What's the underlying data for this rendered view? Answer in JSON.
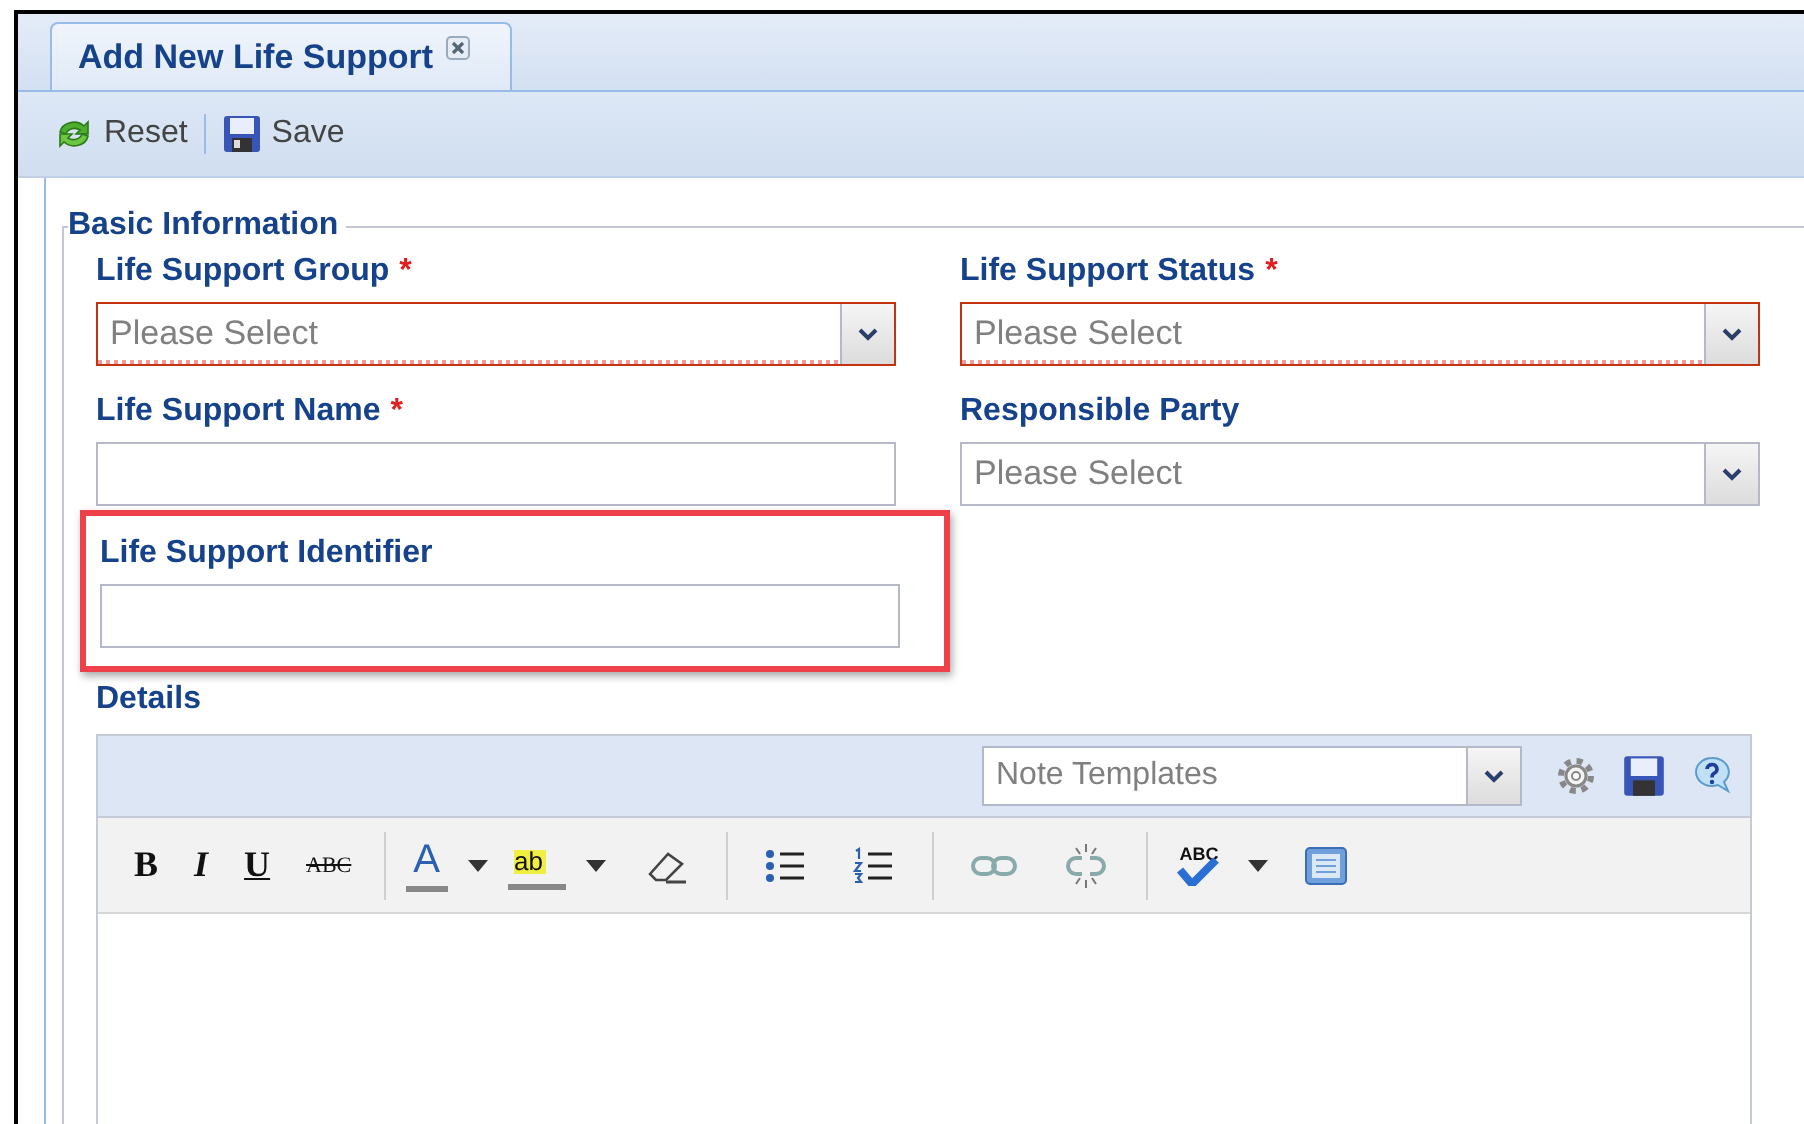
{
  "tab": {
    "label": "Add New Life Support",
    "selected": true
  },
  "toolbar": [
    {
      "kind": "reset",
      "label": "Reset"
    },
    {
      "kind": "save",
      "label": "Save"
    }
  ],
  "fieldset": {
    "legend": "Basic Information"
  },
  "fields": [
    {
      "kind": "select",
      "label": "Life Support Group",
      "required_mark": "*",
      "placeholder": "Please Select",
      "invalid": true,
      "highlighted": false
    },
    {
      "kind": "select",
      "label": "Life Support Status",
      "required_mark": "*",
      "placeholder": "Please Select",
      "invalid": true,
      "highlighted": false
    },
    {
      "kind": "text",
      "label": "Life Support Name",
      "required_mark": "*",
      "invalid": false,
      "highlighted": false
    },
    {
      "kind": "select",
      "label": "Responsible Party",
      "placeholder": "Please Select",
      "invalid": false,
      "highlighted": false
    },
    {
      "kind": "text",
      "label": "Life Support Identifier",
      "invalid": false,
      "highlighted": true
    }
  ],
  "details": {
    "label": "Details",
    "template_select": {
      "placeholder": "Note Templates"
    },
    "format_tools": [
      {
        "kind": "bold",
        "text": "B"
      },
      {
        "kind": "italic",
        "text": "I"
      },
      {
        "kind": "underline",
        "text": "U"
      },
      {
        "kind": "strike",
        "text": "ABC"
      },
      {
        "kind": "sep"
      },
      {
        "kind": "color",
        "text": "A"
      },
      {
        "kind": "caret"
      },
      {
        "kind": "highlight",
        "text": "ab"
      },
      {
        "kind": "caret"
      },
      {
        "kind": "eraser"
      },
      {
        "kind": "sep"
      },
      {
        "kind": "bullets"
      },
      {
        "kind": "numbers"
      },
      {
        "kind": "sep"
      },
      {
        "kind": "link"
      },
      {
        "kind": "unlink"
      },
      {
        "kind": "sep"
      },
      {
        "kind": "spell",
        "text": "ABC"
      },
      {
        "kind": "caret"
      },
      {
        "kind": "view"
      }
    ]
  }
}
